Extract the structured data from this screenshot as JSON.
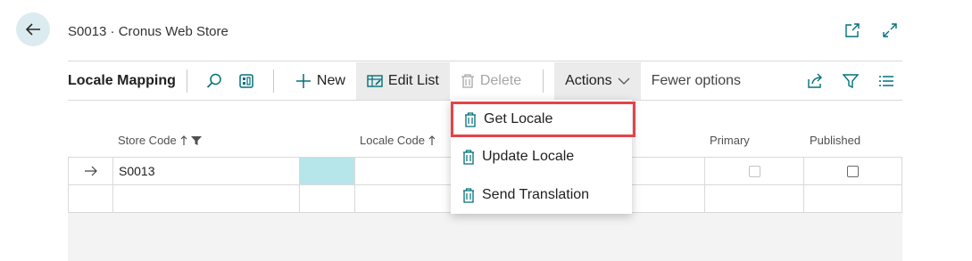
{
  "header": {
    "title": "S0013 · Cronus Web Store"
  },
  "toolbar": {
    "page_name": "Locale Mapping",
    "new_label": "New",
    "edit_list_label": "Edit List",
    "delete_label": "Delete",
    "actions_label": "Actions",
    "fewer_options_label": "Fewer options"
  },
  "grid": {
    "columns": {
      "store_code": "Store Code",
      "locale_code": "Locale Code",
      "primary": "Primary",
      "published": "Published"
    },
    "rows": [
      {
        "store_code": "S0013",
        "locale_code": "",
        "primary": false,
        "published": false
      },
      {
        "store_code": "",
        "locale_code": "",
        "primary": false,
        "published": false
      }
    ]
  },
  "actions_menu": {
    "items": [
      {
        "label": "Get Locale",
        "highlighted": true
      },
      {
        "label": "Update Locale",
        "highlighted": false
      },
      {
        "label": "Send Translation",
        "highlighted": false
      }
    ]
  },
  "colors": {
    "accent": "#00707a",
    "highlight": "#e5434a",
    "selected_cell": "#b6e6ea"
  }
}
